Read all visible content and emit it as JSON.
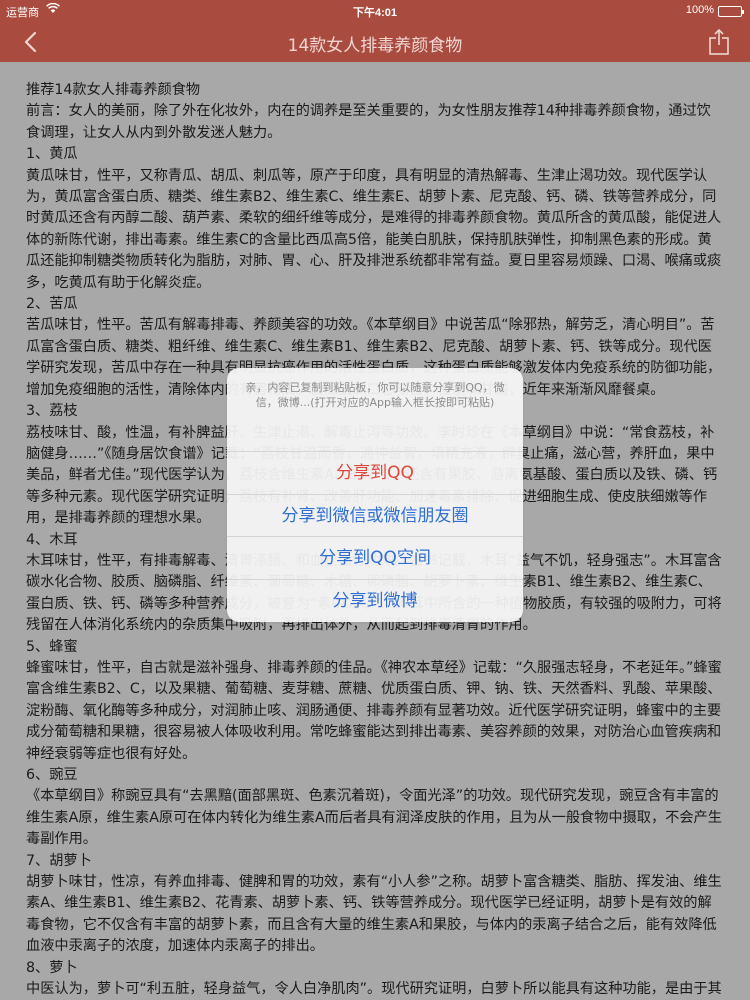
{
  "status_bar": {
    "carrier": "运营商",
    "time": "下午4:01",
    "battery": "100%",
    "battery_level": 1.0
  },
  "nav": {
    "title": "14款女人排毒养颜食物",
    "back_icon": "chevron-left-icon",
    "share_icon": "share-icon"
  },
  "article": {
    "paragraphs": [
      "推荐14款女人排毒养颜食物",
      "前言：女人的美丽，除了外在化妆外，内在的调养是至关重要的，为女性朋友推荐14种排毒养颜食物，通过饮食调理，让女人从内到外散发迷人魅力。",
      "1、黄瓜",
      "黄瓜味甘，性平，又称青瓜、胡瓜、刺瓜等，原产于印度，具有明显的清热解毒、生津止渴功效。现代医学认为，黄瓜富含蛋白质、糖类、维生素B2、维生素C、维生素E、胡萝卜素、尼克酸、钙、磷、铁等营养成分，同时黄瓜还含有丙醇二酸、葫芦素、柔软的细纤维等成分，是难得的排毒养颜食物。黄瓜所含的黄瓜酸，能促进人体的新陈代谢，排出毒素。维生素C的含量比西瓜高5倍，能美白肌肤，保持肌肤弹性，抑制黑色素的形成。黄瓜还能抑制糖类物质转化为脂肪，对肺、胃、心、肝及排泄系统都非常有益。夏日里容易烦躁、口渴、喉痛或痰多，吃黄瓜有助于化解炎症。",
      "2、苦瓜",
      "苦瓜味甘，性平。苦瓜有解毒排毒、养颜美容的功效。《本草纲目》中说苦瓜“除邪热，解劳乏，清心明目”。苦瓜富含蛋白质、糖类、粗纤维、维生素C、维生素B1、维生素B2、尼克酸、胡萝卜素、钙、铁等成分。现代医学研究发现，苦瓜中存在一种具有明显抗癌作用的活性蛋白质，这种蛋白质能够激发体内免疫系统的防御功能，增加免疫细胞的活性，清除体内的有害物质。苦瓜虽然口感略苦，但余味甘甜，近年来渐渐风靡餐桌。",
      "3、荔枝",
      "荔枝味甘、酸，性温，有补脾益肝、生津止渴、解毒止泻等功效。李时珍在《本草纲目》中说：“常食荔枝，补脑健身……”《随身居饮食谱》记载：“荔枝甘温而香，通神益智，填精充液，辟臭止痛，滋心营，养肝血，果中美品，鲜者尤佳。”现代医学认为，荔枝含维生素A、B1、C，还含有果胶、游离氨基酸、蛋白质以及铁、磷、钙等多种元素。现代医学研究证明，荔枝有补肾、改善肝功能、加速毒素排除、促进细胞生成、使皮肤细嫩等作用，是排毒养颜的理想水果。",
      "4、木耳",
      "木耳味甘，性平，有排毒解毒、清胃涤肠、和血止血等功效。古书记载，木耳“益气不饥，轻身强志”。木耳富含碳水化合物、胶质、脑磷脂、纤维素、葡萄糖、木糖、卵磷脂、胡萝卜素、维生素B1、维生素B2、维生素C、蛋白质、铁、钙、磷等多种营养成分，被誉为“素中之荤”。木耳中所含的一种植物胶质，有较强的吸附力，可将残留在人体消化系统内的杂质集中吸附，再排出体外，从而起到排毒清胃的作用。",
      "5、蜂蜜",
      "蜂蜜味甘，性平，自古就是滋补强身、排毒养颜的佳品。《神农本草经》记载：“久服强志轻身，不老延年。”蜂蜜富含维生素B2、C，以及果糖、葡萄糖、麦芽糖、蔗糖、优质蛋白质、钾、钠、铁、天然香料、乳酸、苹果酸、淀粉酶、氧化酶等多种成分，对润肺止咳、润肠通便、排毒养颜有显著功效。近代医学研究证明，蜂蜜中的主要成分葡萄糖和果糖，很容易被人体吸收利用。常吃蜂蜜能达到排出毒素、美容养颜的效果，对防治心血管疾病和神经衰弱等症也很有好处。",
      "6、豌豆",
      "《本草纲目》称豌豆具有“去黑黯(面部黑斑、色素沉着斑)，令面光泽”的功效。现代研究发现，豌豆含有丰富的维生素A原，维生素A原可在体内转化为维生素A而后者具有润泽皮肤的作用，且为从一般食物中摄取，不会产生毒副作用。",
      "7、胡萝卜",
      "胡萝卜味甘，性凉，有养血排毒、健脾和胃的功效，素有“小人参”之称。胡萝卜富含糖类、脂肪、挥发油、维生素A、维生素B1、维生素B2、花青素、胡萝卜素、钙、铁等营养成分。现代医学已经证明，胡萝卜是有效的解毒食物，它不仅含有丰富的胡萝卜素，而且含有大量的维生素A和果胶，与体内的汞离子结合之后，能有效降低血液中汞离子的浓度，加速体内汞离子的排出。",
      "8、萝卜",
      "中医认为，萝卜可“利五脏，轻身益气，令人白净肌肉”。现代研究证明，白萝卜所以能具有这种功能，是由于其含有丰富的维生素C，因而常食可抑制黑色素的形成，减轻皮肤色素的沉积。一些学者认为，肠道不畅，肠道内大肠会分解蛋白质产生有毒的氨类物质，吸收进入血液后会对人体产生不良影"
    ]
  },
  "share_sheet": {
    "message": "亲，内容已复制到粘贴板，你可以随意分享到QQ，微信，微博...(打开对应的App输入框长按即可粘贴)",
    "actions": {
      "qq": "分享到QQ",
      "wechat": "分享到微信或微信朋友圈",
      "qzone": "分享到QQ空间",
      "weibo": "分享到微博"
    }
  }
}
